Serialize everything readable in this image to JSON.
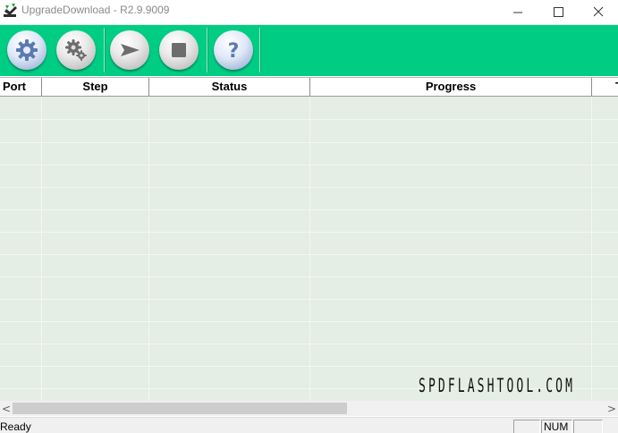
{
  "window": {
    "title": "UpgradeDownload - R2.9.9009",
    "app_icon": "spd-download-icon",
    "controls": [
      "minimize-icon",
      "maximize-icon",
      "close-icon"
    ]
  },
  "toolbar": {
    "background": "#00cd84",
    "buttons": [
      {
        "name": "load-packet-button",
        "icon": "gear-icon"
      },
      {
        "name": "settings-button",
        "icon": "gears-icon"
      },
      {
        "name": "start-download-button",
        "icon": "play-arrow-icon"
      },
      {
        "name": "stop-download-button",
        "icon": "stop-square-icon"
      },
      {
        "name": "help-button",
        "icon": "question-icon"
      }
    ]
  },
  "grid": {
    "columns": [
      "Port",
      "Step",
      "Status",
      "Progress",
      "T"
    ],
    "rows": [],
    "background": "#e4eee4"
  },
  "watermark": "SPDFLASHTOOL.COM",
  "scrollbar": {
    "left_arrow": "<",
    "right_arrow": ">"
  },
  "statusbar": {
    "text": "Ready",
    "panes": [
      "",
      "NUM",
      ""
    ]
  }
}
